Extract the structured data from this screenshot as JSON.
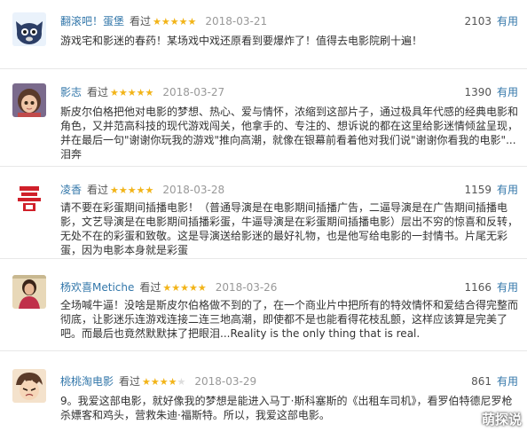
{
  "reviews": [
    {
      "user": "翻滚吧！蛋堡",
      "watched": "看过",
      "rating": 5,
      "date": "2018-03-21",
      "votes": "2103",
      "useful": "有用",
      "text": "游戏宅和影迷的春药！某场戏中戏还原看到要爆炸了！值得去电影院刷十遍！"
    },
    {
      "user": "影志",
      "watched": "看过",
      "rating": 5,
      "date": "2018-03-27",
      "votes": "1390",
      "useful": "有用",
      "text": "斯皮尔伯格把他对电影的梦想、热心、爱与情怀，浓缩到这部片子，通过极具年代感的经典电影和角色，又并范高科技的现代游戏闯关，他拿手的、专注的、想诉说的都在这里给影迷情倾盆呈现，并在最后一句\"谢谢你玩我的游戏\"推向高潮，就像在银幕前看着他对我们说\"谢谢你看我的电影\"...泪奔"
    },
    {
      "user": "凌香",
      "watched": "看过",
      "rating": 5,
      "date": "2018-03-28",
      "votes": "1159",
      "useful": "有用",
      "text": "请不要在彩蛋期间插播电影！（普通导演是在电影期间插播广告，二逼导演是在广告期间插播电影，文艺导演是在电影期间插播彩蛋，牛逼导演是在彩蛋期间插播电影）层出不穷的惊喜和反转，无处不在的彩蛋和致敬。这是导演送给影迷的最好礼物，也是他写给电影的一封情书。片尾无彩蛋，因为电影本身就是彩蛋"
    },
    {
      "user": "杨欢喜Metiche",
      "watched": "看过",
      "rating": 5,
      "date": "2018-03-26",
      "votes": "1166",
      "useful": "有用",
      "text": "全场喊牛逼！没啥是斯皮尔伯格做不到的了，在一个商业片中把所有的特效情怀和爱结合得完整而彻底，让影迷乐连游戏连接二连三地高潮，即使都不是也能看得花枝乱颤，这样应该算是完美了吧。而最后也竟然默默抹了把眼泪...Reality is the only thing that is real."
    },
    {
      "user": "桃桃淘电影",
      "watched": "看过",
      "rating": 4,
      "date": "2018-03-29",
      "votes": "861",
      "useful": "有用",
      "text": "9。我爱这部电影，就好像我的梦想是能进入马丁·斯科塞斯的《出租车司机》，看罗伯特德尼罗枪杀嫖客和鸡头，营救朱迪·福斯特。所以，我爱这部电影。"
    }
  ],
  "watermark": "萌探说",
  "colors": {
    "link": "#3377aa",
    "star": "#f2b418",
    "date": "#999999",
    "divider": "#e8e8e8"
  },
  "icons": {
    "avatar_1": "cartoon-cat-avatar",
    "avatar_2": "animated-girl-avatar",
    "avatar_3": "red-character-logo-avatar",
    "avatar_4": "woman-photo-avatar",
    "avatar_5": "anime-face-avatar",
    "star": "star-icon"
  }
}
